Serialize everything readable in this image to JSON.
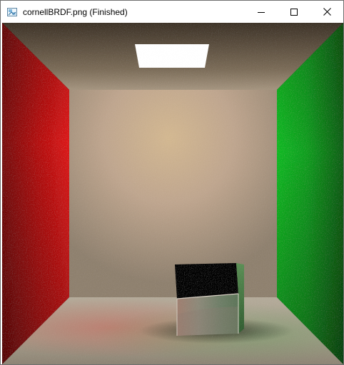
{
  "window": {
    "title": "cornellBRDF.png (Finished)"
  },
  "icons": {
    "app": "image-viewer-icon",
    "minimize": "minimize-icon",
    "maximize": "maximize-icon",
    "close": "close-icon"
  },
  "colors": {
    "left_wall": "#c10d0d",
    "right_wall": "#0ea21c",
    "back_wall": "#c7ad8f",
    "ceiling": "#7d705c",
    "floor": "#b2aa98",
    "light": "#ffffff",
    "cube_dark": "#000000",
    "cube_front": "#6f7a68"
  }
}
